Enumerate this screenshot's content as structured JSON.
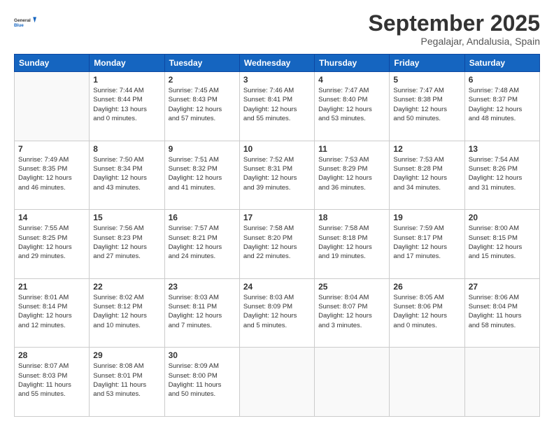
{
  "logo": {
    "line1": "General",
    "line2": "Blue"
  },
  "header": {
    "month": "September 2025",
    "location": "Pegalajar, Andalusia, Spain"
  },
  "weekdays": [
    "Sunday",
    "Monday",
    "Tuesday",
    "Wednesday",
    "Thursday",
    "Friday",
    "Saturday"
  ],
  "weeks": [
    [
      {
        "day": "",
        "info": ""
      },
      {
        "day": "1",
        "info": "Sunrise: 7:44 AM\nSunset: 8:44 PM\nDaylight: 13 hours\nand 0 minutes."
      },
      {
        "day": "2",
        "info": "Sunrise: 7:45 AM\nSunset: 8:43 PM\nDaylight: 12 hours\nand 57 minutes."
      },
      {
        "day": "3",
        "info": "Sunrise: 7:46 AM\nSunset: 8:41 PM\nDaylight: 12 hours\nand 55 minutes."
      },
      {
        "day": "4",
        "info": "Sunrise: 7:47 AM\nSunset: 8:40 PM\nDaylight: 12 hours\nand 53 minutes."
      },
      {
        "day": "5",
        "info": "Sunrise: 7:47 AM\nSunset: 8:38 PM\nDaylight: 12 hours\nand 50 minutes."
      },
      {
        "day": "6",
        "info": "Sunrise: 7:48 AM\nSunset: 8:37 PM\nDaylight: 12 hours\nand 48 minutes."
      }
    ],
    [
      {
        "day": "7",
        "info": "Sunrise: 7:49 AM\nSunset: 8:35 PM\nDaylight: 12 hours\nand 46 minutes."
      },
      {
        "day": "8",
        "info": "Sunrise: 7:50 AM\nSunset: 8:34 PM\nDaylight: 12 hours\nand 43 minutes."
      },
      {
        "day": "9",
        "info": "Sunrise: 7:51 AM\nSunset: 8:32 PM\nDaylight: 12 hours\nand 41 minutes."
      },
      {
        "day": "10",
        "info": "Sunrise: 7:52 AM\nSunset: 8:31 PM\nDaylight: 12 hours\nand 39 minutes."
      },
      {
        "day": "11",
        "info": "Sunrise: 7:53 AM\nSunset: 8:29 PM\nDaylight: 12 hours\nand 36 minutes."
      },
      {
        "day": "12",
        "info": "Sunrise: 7:53 AM\nSunset: 8:28 PM\nDaylight: 12 hours\nand 34 minutes."
      },
      {
        "day": "13",
        "info": "Sunrise: 7:54 AM\nSunset: 8:26 PM\nDaylight: 12 hours\nand 31 minutes."
      }
    ],
    [
      {
        "day": "14",
        "info": "Sunrise: 7:55 AM\nSunset: 8:25 PM\nDaylight: 12 hours\nand 29 minutes."
      },
      {
        "day": "15",
        "info": "Sunrise: 7:56 AM\nSunset: 8:23 PM\nDaylight: 12 hours\nand 27 minutes."
      },
      {
        "day": "16",
        "info": "Sunrise: 7:57 AM\nSunset: 8:21 PM\nDaylight: 12 hours\nand 24 minutes."
      },
      {
        "day": "17",
        "info": "Sunrise: 7:58 AM\nSunset: 8:20 PM\nDaylight: 12 hours\nand 22 minutes."
      },
      {
        "day": "18",
        "info": "Sunrise: 7:58 AM\nSunset: 8:18 PM\nDaylight: 12 hours\nand 19 minutes."
      },
      {
        "day": "19",
        "info": "Sunrise: 7:59 AM\nSunset: 8:17 PM\nDaylight: 12 hours\nand 17 minutes."
      },
      {
        "day": "20",
        "info": "Sunrise: 8:00 AM\nSunset: 8:15 PM\nDaylight: 12 hours\nand 15 minutes."
      }
    ],
    [
      {
        "day": "21",
        "info": "Sunrise: 8:01 AM\nSunset: 8:14 PM\nDaylight: 12 hours\nand 12 minutes."
      },
      {
        "day": "22",
        "info": "Sunrise: 8:02 AM\nSunset: 8:12 PM\nDaylight: 12 hours\nand 10 minutes."
      },
      {
        "day": "23",
        "info": "Sunrise: 8:03 AM\nSunset: 8:11 PM\nDaylight: 12 hours\nand 7 minutes."
      },
      {
        "day": "24",
        "info": "Sunrise: 8:03 AM\nSunset: 8:09 PM\nDaylight: 12 hours\nand 5 minutes."
      },
      {
        "day": "25",
        "info": "Sunrise: 8:04 AM\nSunset: 8:07 PM\nDaylight: 12 hours\nand 3 minutes."
      },
      {
        "day": "26",
        "info": "Sunrise: 8:05 AM\nSunset: 8:06 PM\nDaylight: 12 hours\nand 0 minutes."
      },
      {
        "day": "27",
        "info": "Sunrise: 8:06 AM\nSunset: 8:04 PM\nDaylight: 11 hours\nand 58 minutes."
      }
    ],
    [
      {
        "day": "28",
        "info": "Sunrise: 8:07 AM\nSunset: 8:03 PM\nDaylight: 11 hours\nand 55 minutes."
      },
      {
        "day": "29",
        "info": "Sunrise: 8:08 AM\nSunset: 8:01 PM\nDaylight: 11 hours\nand 53 minutes."
      },
      {
        "day": "30",
        "info": "Sunrise: 8:09 AM\nSunset: 8:00 PM\nDaylight: 11 hours\nand 50 minutes."
      },
      {
        "day": "",
        "info": ""
      },
      {
        "day": "",
        "info": ""
      },
      {
        "day": "",
        "info": ""
      },
      {
        "day": "",
        "info": ""
      }
    ]
  ]
}
